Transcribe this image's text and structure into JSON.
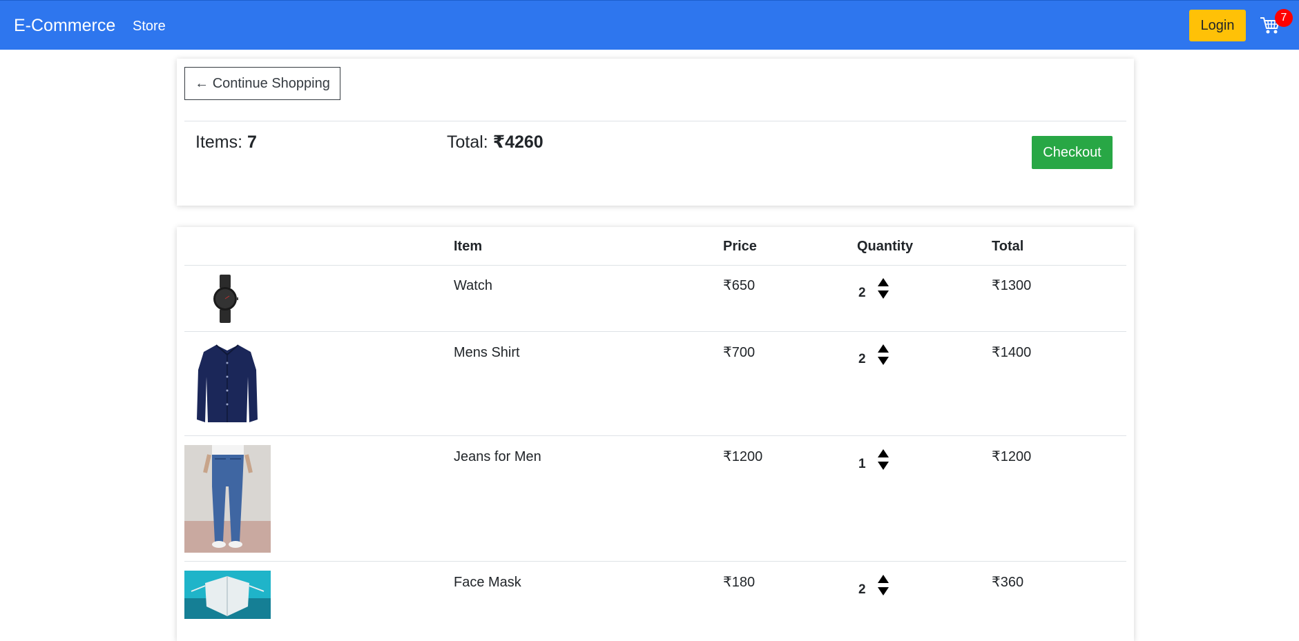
{
  "navbar": {
    "brand": "E-Commerce",
    "store_link": "Store",
    "login_label": "Login",
    "cart_count": "7",
    "cart_icon": "shopping-cart-icon",
    "bg_color": "#2e76ee"
  },
  "summary": {
    "continue_label": "← Continue Shopping",
    "items_label": "Items: ",
    "items_value": "7",
    "total_label": "Total: ",
    "total_value": "₹4260",
    "checkout_label": "Checkout"
  },
  "table": {
    "headers": [
      "Item",
      "Price",
      "Quantity",
      "Total"
    ],
    "rows": [
      {
        "item": "Watch",
        "price": "₹650",
        "quantity": "2",
        "total": "₹1300",
        "image": "watch-image"
      },
      {
        "item": "Mens Shirt",
        "price": "₹700",
        "quantity": "2",
        "total": "₹1400",
        "image": "shirt-image"
      },
      {
        "item": "Jeans for Men",
        "price": "₹1200",
        "quantity": "1",
        "total": "₹1200",
        "image": "jeans-image"
      },
      {
        "item": "Face Mask",
        "price": "₹180",
        "quantity": "2",
        "total": "₹360",
        "image": "face-mask-image"
      }
    ]
  },
  "colors": {
    "login": "#ffc107",
    "checkout": "#28a745",
    "badge": "#ff0000"
  }
}
